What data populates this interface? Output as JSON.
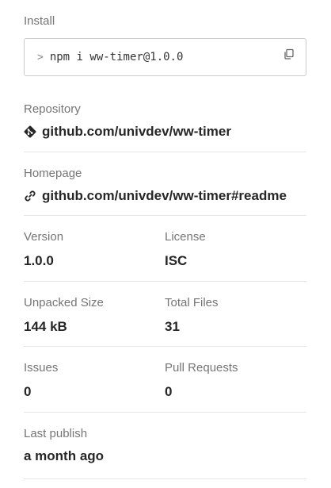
{
  "install": {
    "label": "Install",
    "prompt": ">",
    "command": "npm i ww-timer@1.0.0",
    "copy_icon": "copy-icon"
  },
  "repository": {
    "label": "Repository",
    "icon": "git-icon",
    "link": "github.com/univdev/ww-timer"
  },
  "homepage": {
    "label": "Homepage",
    "icon": "link-icon",
    "link": "github.com/univdev/ww-timer#readme"
  },
  "version": {
    "label": "Version",
    "value": "1.0.0"
  },
  "license": {
    "label": "License",
    "value": "ISC"
  },
  "unpacked_size": {
    "label": "Unpacked Size",
    "value": "144 kB"
  },
  "total_files": {
    "label": "Total Files",
    "value": "31"
  },
  "issues": {
    "label": "Issues",
    "value": "0"
  },
  "pull_requests": {
    "label": "Pull Requests",
    "value": "0"
  },
  "last_publish": {
    "label": "Last publish",
    "value": "a month ago"
  }
}
